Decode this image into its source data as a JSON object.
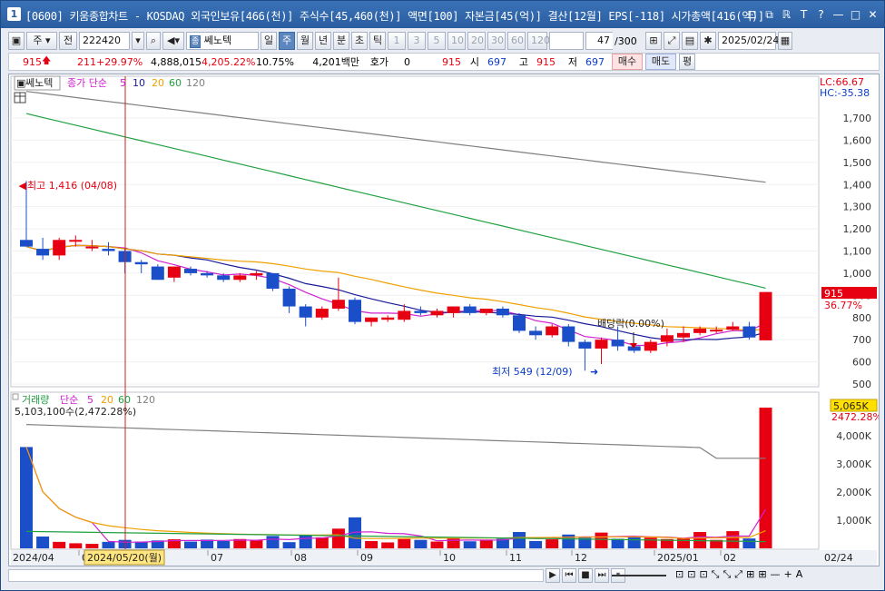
{
  "window": {
    "app_number": "1",
    "title": "[0600] 키움종합차트 - KOSDAQ 외국인보유[466(천)] 주식수[45,460(천)] 액면[100] 자본금[45(억)] 결산[12월] EPS[-118] 시가총액[416(억)]",
    "controls": [
      "⊡",
      "⧉",
      "ℝ",
      "T",
      "?",
      "—",
      "□",
      "✕"
    ]
  },
  "toolbar": {
    "type_label": "주",
    "prev_label": "전",
    "code_value": "222420",
    "stock_badge": "종",
    "stock_name": "쎄노텍",
    "periods": [
      "일",
      "주",
      "월",
      "년",
      "분",
      "초",
      "틱"
    ],
    "active_period": "주",
    "intervals": [
      "1",
      "3",
      "5",
      "10",
      "20",
      "30",
      "60",
      "120"
    ],
    "count_value": "47",
    "count_total": "/300",
    "date_value": "2025/02/24"
  },
  "quote": {
    "price": "915",
    "change": "211",
    "change_pct": "+29.97%",
    "volume": "4,888,015",
    "vol_ratio": "4,205.22%",
    "turnover": "10.75%",
    "amount": "4,201백만",
    "hoga_label": "호가",
    "hoga_value": "0",
    "hoga_price": "915",
    "open_label": "시",
    "open_value": "697",
    "high_label": "고",
    "high_value": "915",
    "low_label": "저",
    "low_value": "697",
    "buy_label": "매수",
    "sell_label": "매도",
    "eval_label": "평"
  },
  "legend": {
    "stock_name": "쎄노텍",
    "ma_label": "종가 단순",
    "ma_periods": [
      "5",
      "10",
      "20",
      "60",
      "120"
    ],
    "ma_colors": [
      "#d020d0",
      "#1a1a9a",
      "#f0a000",
      "#20a040",
      "#808080"
    ],
    "lc": "LC:66.67",
    "hc": "HC:-35.38",
    "high_annotation": "최고 1,416 (04/08)",
    "low_annotation": "최저 549 (12/09)",
    "dividend_annotation": "배당락(0.00%)",
    "price_tag": "915",
    "price_tag_pct": "36.77%"
  },
  "volume_panel": {
    "title": "거래량",
    "ma_label": "단순",
    "ma_periods": [
      "5",
      "20",
      "60",
      "120"
    ],
    "ma_colors": [
      "#d020d0",
      "#f0a000",
      "#20a040",
      "#808080"
    ],
    "total_label": "5,103,100수(2,472.28%)",
    "tag": "5,065K",
    "tag_pct": "2472.28%"
  },
  "price_axis": [
    "1,700",
    "1,600",
    "1,500",
    "1,400",
    "1,300",
    "1,200",
    "1,100",
    "1,000",
    "900",
    "800",
    "700",
    "600",
    "500"
  ],
  "volume_axis": [
    "4,000K",
    "3,000K",
    "2,000K",
    "1,000K"
  ],
  "x_axis": {
    "labels": [
      "2024/04",
      "05",
      "07",
      "08",
      "09",
      "10",
      "11",
      "12",
      "2025/01",
      "02",
      "02/24"
    ],
    "cursor_label": "2024/05/20(월)"
  },
  "bottom_controls": [
    "▶",
    "⏮",
    "■",
    "⏭",
    "⏸",
    "—",
    "+",
    "A"
  ]
}
